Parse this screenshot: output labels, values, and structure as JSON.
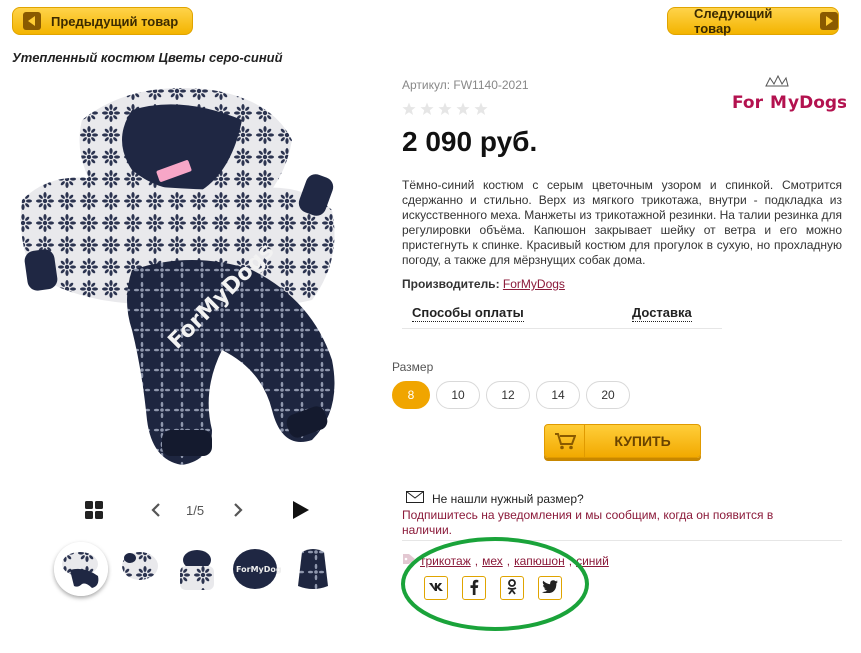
{
  "nav": {
    "prev_label": "Предыдущий товар",
    "next_label": "Следующий товар"
  },
  "product": {
    "title": "Утепленный костюм Цветы серо-синий",
    "article": "Артикул: FW1140-2021",
    "rating_stars": 0,
    "price": "2 090 руб.",
    "description": "Тёмно-синий костюм с серым цветочным узором и спинкой. Смотрится сдержанно и стильно. Верх из мягкого трикотажа, внутри - подкладка из искусственного меха. Манжеты из трикотажной резинки. На талии резинка для регулировки объёма. Капюшон закрывает шейку от ветра и его можно пристегнуть к спинке. Красивый костюм для прогулок в сухую, но прохладную погоду, а также для мёрзнущих собак дома.",
    "maker_label": "Производитель:",
    "maker_value": "ForMyDogs",
    "brand_logo_text": "ForMyDogs"
  },
  "gallery": {
    "counter": "1/5",
    "thumbs": [
      "thumb-1",
      "thumb-2",
      "thumb-3",
      "thumb-4",
      "thumb-5"
    ]
  },
  "tabs": {
    "payment": "Способы оплаты",
    "delivery": "Доставка"
  },
  "sizes": {
    "label": "Размер",
    "options": [
      "8",
      "10",
      "12",
      "14",
      "20"
    ],
    "selected": "8"
  },
  "buy": {
    "label": "КУПИТЬ"
  },
  "notify": {
    "title": "Не нашли нужный размер?",
    "text": "Подпишитесь на уведомления и мы сообщим, когда он появится в наличии."
  },
  "tags": {
    "items": [
      "трикотаж",
      "мех",
      "капюшон",
      "синий"
    ]
  },
  "social": {
    "buttons": [
      "vk-icon",
      "facebook-icon",
      "odnoklassniki-icon",
      "twitter-icon"
    ]
  },
  "colors": {
    "accent": "#f0a500",
    "link": "#8b1a3a",
    "highlight": "#1aa33a"
  }
}
